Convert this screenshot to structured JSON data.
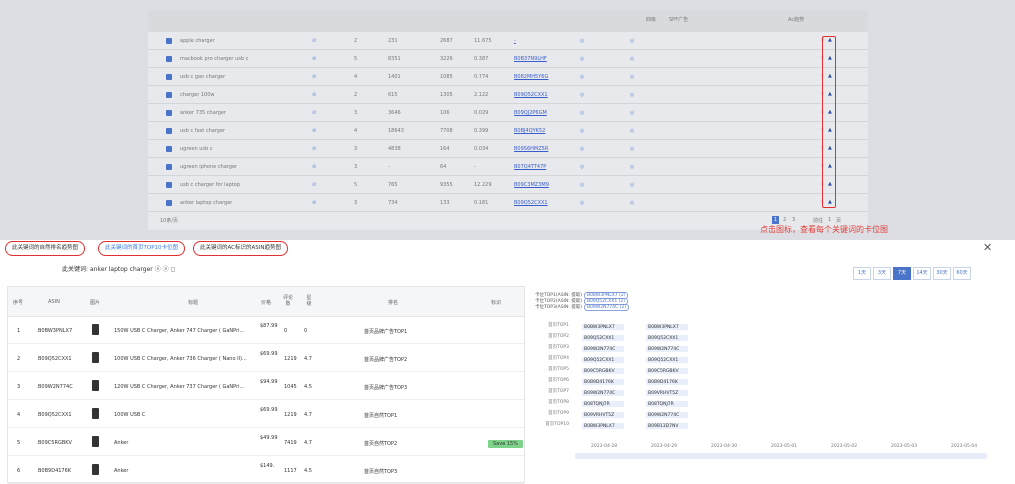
{
  "bg_table": {
    "header_cols": [
      "四级",
      "SPF广告",
      "Ac趋势"
    ],
    "rows": [
      {
        "keyword": "apple charger",
        "n1": "2",
        "n2": "231",
        "n3": "2687",
        "n4": "11.675",
        "asin": "-"
      },
      {
        "keyword": "macbook pro charger usb c",
        "n1": "5",
        "n2": "8351",
        "n3": "3226",
        "n4": "0.387",
        "asin": "B0B37N9LHF"
      },
      {
        "keyword": "usb c gan charger",
        "n1": "4",
        "n2": "1401",
        "n3": "1085",
        "n4": "0.774",
        "asin": "B082MH5Y6G"
      },
      {
        "keyword": "charger 100w",
        "n1": "2",
        "n2": "615",
        "n3": "1305",
        "n4": "2.122",
        "asin": "B09Q52CXX1"
      },
      {
        "keyword": "anker 735 charger",
        "n1": "3",
        "n2": "3646",
        "n3": "106",
        "n4": "0.029",
        "asin": "B09QJ2P6GM"
      },
      {
        "keyword": "usb c fast charger",
        "n1": "4",
        "n2": "18643",
        "n3": "7708",
        "n4": "0.399",
        "asin": "B0BJ4QYK52"
      },
      {
        "keyword": "ugreen usb c",
        "n1": "3",
        "n2": "4838",
        "n3": "164",
        "n4": "0.034",
        "asin": "B09S6HMZ5R"
      },
      {
        "keyword": "ugreen iphone charger",
        "n1": "3",
        "n2": "-",
        "n3": "64",
        "n4": "-",
        "asin": "B07Q4TT47P"
      },
      {
        "keyword": "usb c charger for laptop",
        "n1": "5",
        "n2": "765",
        "n3": "9355",
        "n4": "12.229",
        "asin": "B09C3MZ3M9"
      },
      {
        "keyword": "anker laptop charger",
        "n1": "3",
        "n2": "734",
        "n3": "133",
        "n4": "0.181",
        "asin": "B09Q52CXX1"
      }
    ],
    "page_size": "10条/页",
    "pages": [
      "1",
      "2",
      "3"
    ],
    "goto_label": "前往",
    "goto_value": "1",
    "page_suffix": "页"
  },
  "hint_text": "点击图标，查看每个关键词的卡位图",
  "tabs": [
    {
      "label": "此关键词的自然排名趋势图",
      "active": false
    },
    {
      "label": "此关键词的首页TOP10卡位图",
      "active": true
    },
    {
      "label": "此关键词的AC标识的ASIN趋势图",
      "active": false
    }
  ],
  "keyword_line": {
    "prefix": "此关键词:",
    "keyword": "anker laptop charger"
  },
  "day_buttons": [
    {
      "label": "1天",
      "active": false
    },
    {
      "label": "3天",
      "active": false
    },
    {
      "label": "7天",
      "active": true
    },
    {
      "label": "14天",
      "active": false
    },
    {
      "label": "30天",
      "active": false
    },
    {
      "label": "60天",
      "active": false
    }
  ],
  "product_table": {
    "headers": [
      "序号",
      "ASIN",
      "图片",
      "标题",
      "价格",
      "评论数",
      "星级",
      "排名",
      "标识"
    ],
    "rows": [
      {
        "idx": "1",
        "asin": "B0BW3PNLX7",
        "title": "150W USB C Charger, Anker 747 Charger ( GaNPri...",
        "price": "$87.99",
        "reviews": "0",
        "stars": "0",
        "rank": "首页品牌广告TOP1",
        "badge": ""
      },
      {
        "idx": "2",
        "asin": "B09Q52CXX1",
        "title": "100W USB C Charger, Anker 736 Charger ( Nano II)...",
        "price": "$69.99",
        "reviews": "1219",
        "stars": "4.7",
        "rank": "首页品牌广告TOP2",
        "badge": ""
      },
      {
        "idx": "3",
        "asin": "B09W2N774C",
        "title": "120W USB C Charger, Anker 737 Charger ( GaNPri...",
        "price": "$94.99",
        "reviews": "1045",
        "stars": "4.5",
        "rank": "首页品牌广告TOP3",
        "badge": ""
      },
      {
        "idx": "4",
        "asin": "B09Q52CXX1",
        "title": "100W USB C",
        "price": "$69.99",
        "reviews": "1219",
        "stars": "4.7",
        "rank": "首页自然TOP1",
        "badge": ""
      },
      {
        "idx": "5",
        "asin": "B09C5RGBKV",
        "title": "Anker",
        "price": "$49.99",
        "reviews": "7419",
        "stars": "4.7",
        "rank": "首页自然TOP2",
        "badge": "Save 15%"
      },
      {
        "idx": "6",
        "asin": "B0B9D4176K",
        "title": "Anker",
        "price": "$149.",
        "reviews": "1117",
        "stars": "4.5",
        "rank": "首页自然TOP3",
        "badge": ""
      }
    ]
  },
  "chart_data": {
    "type": "table",
    "legend": [
      {
        "label": "卡位TOP1(ASIN: 提取)",
        "asin": "B0BW3PNLX7 (2)"
      },
      {
        "label": "卡位TOP2(ASIN: 提取)",
        "asin": "B09Q52CXX1 (2)"
      },
      {
        "label": "卡位TOP3(ASIN: 提取)",
        "asin": "B09W2N774C (2)"
      }
    ],
    "y_labels": [
      "首页TOP1",
      "首页TOP2",
      "首页TOP3",
      "首页TOP4",
      "首页TOP5",
      "首页TOP6",
      "首页TOP7",
      "首页TOP8",
      "首页TOP9",
      "首页TOP10"
    ],
    "x_labels": [
      "2023-04-28",
      "2023-04-29",
      "2023-04-30",
      "2023-05-01",
      "2023-05-02",
      "2023-05-03",
      "2023-05-04"
    ],
    "columns": [
      [
        "B0BW3PNLX7",
        "B09Q52CXX1",
        "B09W2N774C",
        "B09Q52CXX1",
        "B09C5RGBKV",
        "B0B9D4176K",
        "B09W2N774C",
        "B08TQNJ7R",
        "B09VRHVT5Z",
        "B0BW3PNLX7"
      ],
      [
        "B0BW3PNLX7",
        "B09Q52CXX1",
        "B09W2N774C",
        "B09Q52CXX1",
        "B09C5RGBKV",
        "B0B9D4176K",
        "B09VRHVT5Z",
        "B08TQNJ7R",
        "B09W2N774C",
        "B09B13D7NV"
      ]
    ]
  }
}
